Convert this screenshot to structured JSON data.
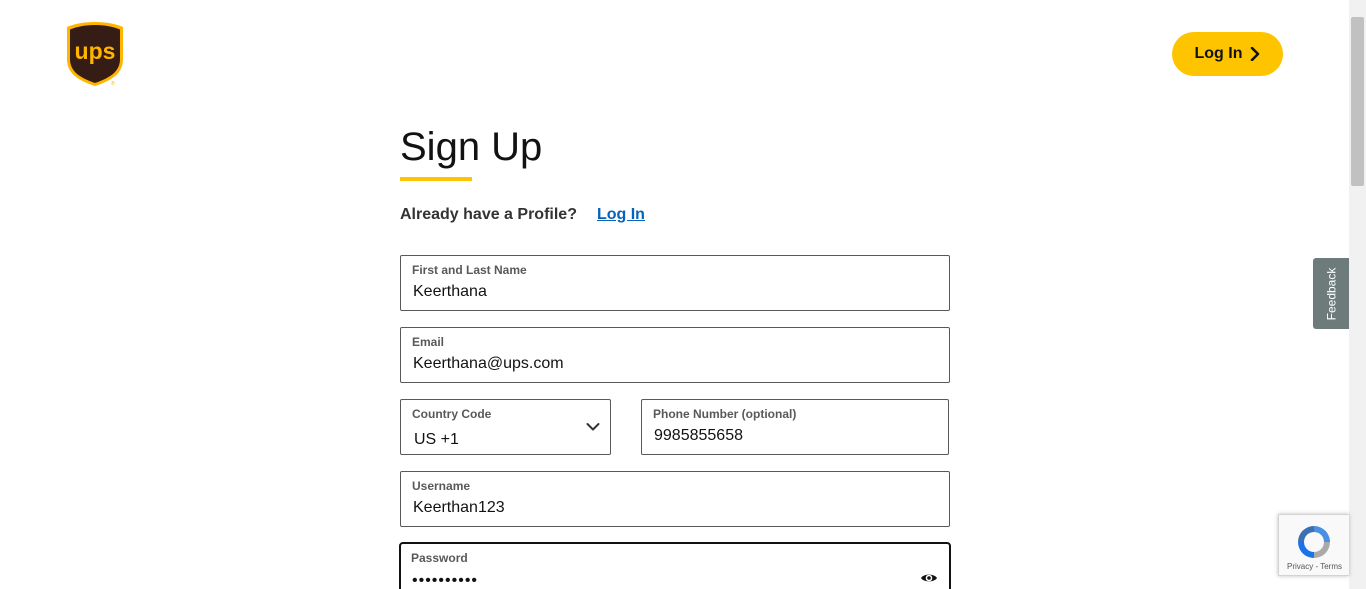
{
  "header": {
    "logo_text": "ups",
    "login_label": "Log In"
  },
  "form": {
    "title": "Sign Up",
    "already_question": "Already have a Profile?",
    "login_link": "Log In",
    "fields": {
      "name": {
        "label": "First and Last Name",
        "value": "Keerthana"
      },
      "email": {
        "label": "Email",
        "value": "Keerthana@ups.com"
      },
      "country_code": {
        "label": "Country Code",
        "value": "US +1"
      },
      "phone": {
        "label": "Phone Number (optional)",
        "value": "9985855658"
      },
      "username": {
        "label": "Username",
        "value": "Keerthan123"
      },
      "password": {
        "label": "Password",
        "value": "••••••••••"
      }
    }
  },
  "feedback": {
    "label": "Feedback"
  },
  "recaptcha": {
    "links": "Privacy - Terms"
  },
  "colors": {
    "brand_yellow": "#ffc400",
    "brand_brown": "#351c15",
    "link_blue": "#0662bb",
    "feedback_gray": "#6e7b7b"
  },
  "icons": {
    "header_login": "chevron-right-icon",
    "country_code": "chevron-down-icon",
    "password": "eye-icon"
  }
}
